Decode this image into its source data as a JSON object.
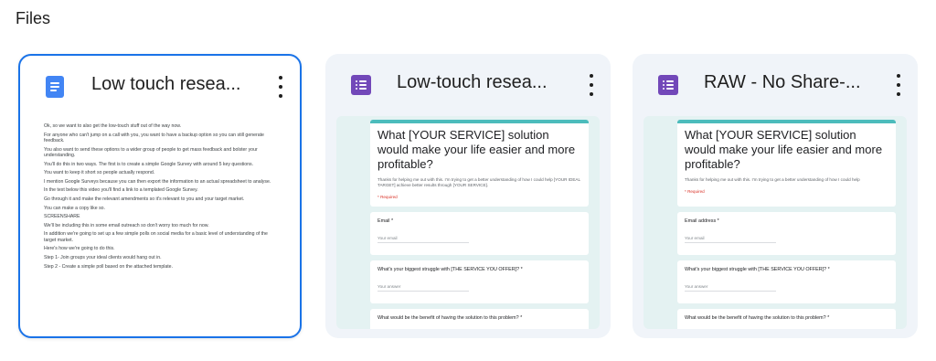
{
  "section": {
    "title": "Files"
  },
  "files": [
    {
      "title": "Low touch resea...",
      "icon": "google-docs-icon",
      "icon_color": "#4285f4",
      "selected": true,
      "preview_lines": [
        "Ok, so we want to also get the low-touch stuff out of the way now.",
        "For anyone who can't jump on a call with you, you want to have a backup option so you can still generate feedback.",
        "You also want to send these options to a wider group of people to get mass feedback and bolster your understanding.",
        "You'll do this in two ways. The first is to create a simple Google Survey with around 5 key questions.",
        "You want to keep it short so people actually respond.",
        "I mention Google Surveys because you can then export the information to an actual spreadsheet to analyse.",
        "In the text below this video you'll find a link to a templated Google Survey.",
        "Go through it and make the relevant amendments so it's relevant to you and your target market.",
        "You can make a copy like so.",
        "SCREENSHARE",
        "We'll be including this in some email outreach so don't worry too much for now.",
        "In addition we're going to set up a few simple polls on social media for a basic level of understanding of the target market.",
        "Here's how we're going to do this.",
        "Step 1- Join groups your ideal clients would hang out in.",
        "Step 2 - Create a simple poll based on the attached template."
      ]
    },
    {
      "title": "Low-touch resea...",
      "icon": "google-forms-icon",
      "icon_color": "#7248b9",
      "selected": false,
      "form": {
        "title": "What [YOUR SERVICE] solution would make your life easier and more profitable?",
        "description": "Thanks for helping me out with this. I'm trying to get a better understanding of how I could help [YOUR IDEAL TARGET] achieve better results through [YOUR SERVICE].",
        "required": "* Required",
        "questions": [
          {
            "label": "Email *",
            "answer": "Your email"
          },
          {
            "label": "What's your biggest struggle with [THE SERVICE YOU OFFER]? *",
            "answer": "Your answer"
          },
          {
            "label": "What would be the benefit of having the solution to this problem? *",
            "answer": ""
          }
        ]
      }
    },
    {
      "title": "RAW - No Share-...",
      "icon": "google-forms-icon",
      "icon_color": "#7248b9",
      "selected": false,
      "form": {
        "title": "What [YOUR SERVICE] solution would make your life easier and more profitable?",
        "description": "Thanks for helping me out with this. I'm trying to get a better understanding of how I could help",
        "required": "* Required",
        "questions": [
          {
            "label": "Email address *",
            "answer": "Your email"
          },
          {
            "label": "What's your biggest struggle with [THE SERVICE YOU OFFER]? *",
            "answer": "Your answer"
          },
          {
            "label": "What would be the benefit of having the solution to this problem? *",
            "answer": ""
          }
        ]
      }
    }
  ]
}
